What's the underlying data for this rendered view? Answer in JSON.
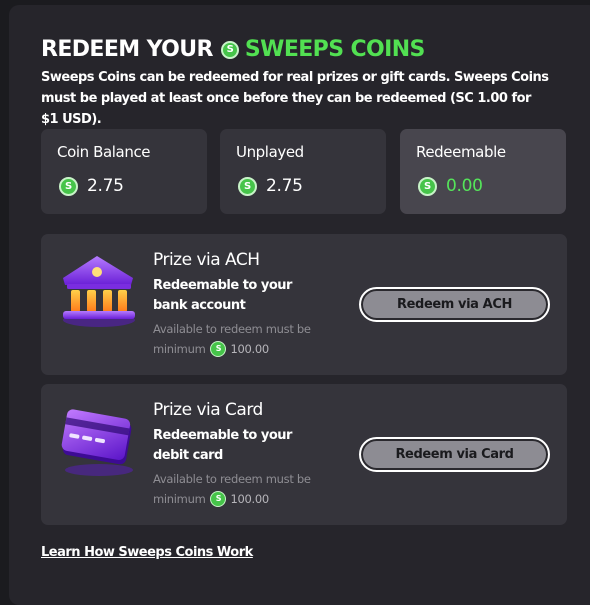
{
  "header": {
    "title_part1": "REDEEM YOUR",
    "title_part2": "SWEEPS COINS",
    "coin_symbol": "S",
    "description": "Sweeps Coins can be redeemed for real prizes or gift cards. Sweeps Coins must be played at least once before they can be redeemed (SC 1.00 for $1 USD)."
  },
  "stats": [
    {
      "label": "Coin Balance",
      "value": "2.75"
    },
    {
      "label": "Unplayed",
      "value": "2.75"
    },
    {
      "label": "Redeemable",
      "value": "0.00"
    }
  ],
  "prizes": [
    {
      "icon": "bank-icon",
      "title": "Prize via ACH",
      "subtitle": "Redeemable to your bank account",
      "note": "Available to redeem must be",
      "min_label": "minimum",
      "min_value": "100.00",
      "button": "Redeem via ACH"
    },
    {
      "icon": "card-icon",
      "title": "Prize via Card",
      "subtitle": "Redeemable to your debit card",
      "note": "Available to redeem must be",
      "min_label": "minimum",
      "min_value": "100.00",
      "button": "Redeem via Card"
    }
  ],
  "footer": {
    "learn_link": "Learn How Sweeps Coins Work"
  },
  "colors": {
    "accent_green": "#52e052",
    "panel_bg": "#26252b",
    "card_bg": "#35343b",
    "highlight_bg": "#48464e",
    "button_bg": "#8d8c93"
  }
}
